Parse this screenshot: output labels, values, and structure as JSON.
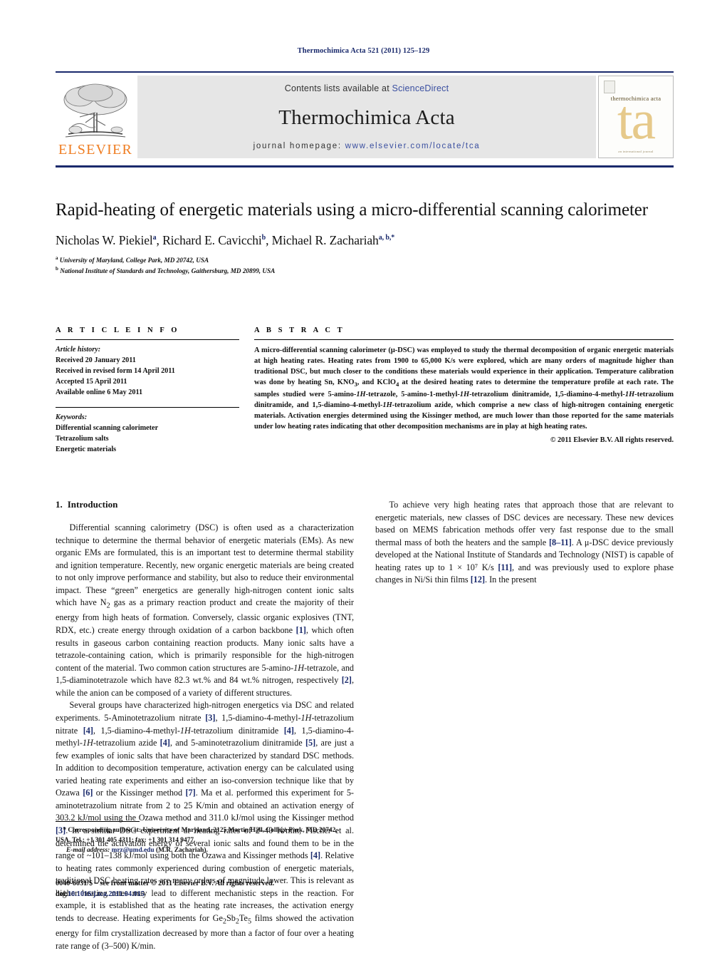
{
  "running_head": "Thermochimica Acta 521 (2011) 125–129",
  "masthead": {
    "contents_prefix": "Contents lists available at ",
    "sciencedirect": "ScienceDirect",
    "journal_title": "Thermochimica Acta",
    "homepage_label": "journal homepage:",
    "homepage_url": "www.elsevier.com/locate/tca",
    "publisher_logo_text": "ELSEVIER",
    "publisher_logo_icon": "elsevier-tree-icon",
    "cover_journal_name": "thermochimica acta",
    "cover_monogram": "ta",
    "cover_footer": "an international journal"
  },
  "article": {
    "title": "Rapid-heating of energetic materials using a micro-differential scanning calorimeter",
    "authors_html": "Nicholas W. Piekiel<sup>a</sup>, Richard E. Cavicchi<sup>b</sup>, Michael R. Zachariah<sup>a, b,</sup><sup>*</sup>",
    "affiliation_a": "University of Maryland, College Park, MD 20742, USA",
    "affiliation_b": "National Institute of Standards and Technology, Gaithersburg, MD 20899, USA"
  },
  "article_info": {
    "heading": "A R T I C L E    I N F O",
    "history_label": "Article history:",
    "history": [
      "Received 20 January 2011",
      "Received in revised form 14 April 2011",
      "Accepted 15 April 2011",
      "Available online 6 May 2011"
    ],
    "keywords_label": "Keywords:",
    "keywords": [
      "Differential scanning calorimeter",
      "Tetrazolium salts",
      "Energetic materials"
    ]
  },
  "abstract": {
    "heading": "A B S T R A C T",
    "text": "A micro-differential scanning calorimeter (μ-DSC) was employed to study the thermal decomposition of organic energetic materials at high heating rates. Heating rates from 1900 to 65,000 K/s were explored, which are many orders of magnitude higher than traditional DSC, but much closer to the conditions these materials would experience in their application. Temperature calibration was done by heating Sn, KNO3, and KClO4 at the desired heating rates to determine the temperature profile at each rate. The samples studied were 5-amino-1H-tetrazole, 5-amino-1-methyl-1H-tetrazolium dinitramide, 1,5-diamino-4-methyl-1H-tetrazolium dinitramide, and 1,5-diamino-4-methyl-1H-tetrazolium azide, which comprise a new class of high-nitrogen containing energetic materials. Activation energies determined using the Kissinger method, are much lower than those reported for the same materials under low heating rates indicating that other decomposition mechanisms are in play at high heating rates.",
    "copyright": "© 2011 Elsevier B.V. All rights reserved."
  },
  "section1": {
    "number": "1.",
    "heading": "Introduction",
    "para1": "Differential scanning calorimetry (DSC) is often used as a characterization technique to determine the thermal behavior of energetic materials (EMs). As new organic EMs are formulated, this is an important test to determine thermal stability and ignition temperature. Recently, new organic energetic materials are being created to not only improve performance and stability, but also to reduce their environmental impact. These “green” energetics are generally high-nitrogen content ionic salts which have N2 gas as a primary reaction product and create the majority of their energy from high heats of formation. Conversely, classic organic explosives (TNT, RDX, etc.) create energy through oxidation of a carbon backbone [1], which often results in gaseous carbon containing reaction products. Many ionic salts have a tetrazole-containing cation, which is primarily responsible for the high-nitrogen content of the material. Two common cation structures are 5-amino-1H-tetrazole, and 1,5-diaminotetrazole which have 82.3 wt.% and 84 wt.% nitrogen, respectively [2], while the anion can be composed of a variety of different structures.",
    "para2": "Several groups have characterized high-nitrogen energetics via DSC and related experiments. 5-Aminotetrazolium nitrate [3], 1,5-diamino-4-methyl-1H-tetrazolium nitrate [4], 1,5-diamino-4-methyl-1H-tetrazolium dinitramide [4], 1,5-diamino-4-methyl-1H-tetrazolium azide [4], and 5-aminotetrazolium dinitramide [5], are just a few examples of ionic salts that have been characterized by standard DSC methods. In addition to decomposition temperature, activation energy can be calculated using varied heating rate experiments and either an iso-conversion technique like that by Ozawa [6] or the Kissinger method [7]. Ma et al. performed this experiment for 5-aminotetrazolium nitrate from 2 to 25 K/min and obtained an activation energy of 303.2 kJ/mol using the Ozawa method and 311.0 kJ/mol using the Kissinger method [3]. In a similar DSC experiment at heating rates of 2–40 K/min, Fischer et al. determined the activation energy of several ionic salts and found them to be in the range of ~101–138 kJ/mol using both the Ozawa and Kissinger methods [4]. Relative to heating rates commonly experienced during combustion of energetic materials, traditional DSC heating rates are many orders of magnitude lower. This is relevant as higher heating rates may lead to different mechanistic steps in the reaction. For example, it is established that as the heating rate increases, the activation energy tends to decrease. Heating experiments for Ge2Sb2Te5 films showed the activation energy for film crystallization decreased by more than a factor of four over a heating rate range of (3–500) K/min.",
    "para3": "To achieve very high heating rates that approach those that are relevant to energetic materials, new classes of DSC devices are necessary. These new devices based on MEMS fabrication methods offer very fast response due to the small thermal mass of both the heaters and the sample [8–11]. A μ-DSC device previously developed at the National Institute of Standards and Technology (NIST) is capable of heating rates up to 1 × 10⁷ K/s [11], and was previously used to explore phase changes in Ni/Si thin films [12]. In the present"
  },
  "footnote": {
    "corresponding": "* Corresponding author at: University of Maryland, 2125 Martin Hall, College Park, MD 20742, USA. Tel.: +1 301 405 4311; fax: +1 301 314 9477.",
    "email_label": "E-mail address:",
    "email": "mrz@umd.edu",
    "email_owner": "(M.R. Zachariah)."
  },
  "footer": {
    "issn_line": "0040-6031/$ – see front matter © 2011 Elsevier B.V. All rights reserved.",
    "doi_label": "doi:",
    "doi_value": "10.1016/j.tca.2011.04.015"
  }
}
